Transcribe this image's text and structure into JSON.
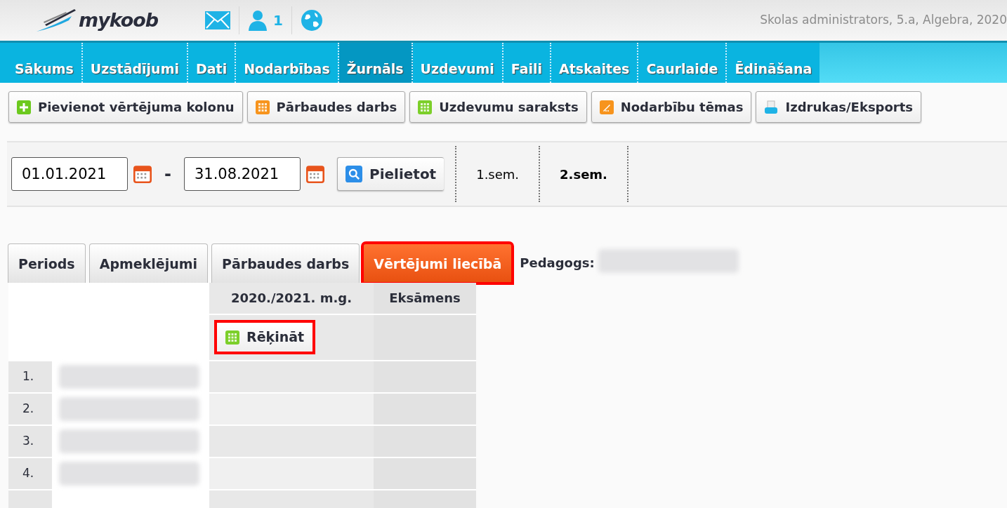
{
  "header": {
    "logo": "mykoob",
    "user_count": "1",
    "context": "Skolas administrators, 5.a, Algebra, 2020"
  },
  "nav": [
    {
      "label": "Sākums",
      "selected": false
    },
    {
      "label": "Uzstādījumi",
      "selected": false
    },
    {
      "label": "Dati",
      "selected": false
    },
    {
      "label": "Nodarbības",
      "selected": false
    },
    {
      "label": "Žurnāls",
      "selected": true
    },
    {
      "label": "Uzdevumi",
      "selected": false
    },
    {
      "label": "Faili",
      "selected": false
    },
    {
      "label": "Atskaites",
      "selected": false
    },
    {
      "label": "Caurlaide",
      "selected": false
    },
    {
      "label": "Ēdināšana",
      "selected": false
    }
  ],
  "toolbar": [
    "Pievienot vērtējuma kolonu",
    "Pārbaudes darbs",
    "Uzdevumu saraksts",
    "Nodarbību tēmas",
    "Izdrukas/Eksports"
  ],
  "date_filter": {
    "from": "01.01.2021",
    "separator": "-",
    "to": "31.08.2021",
    "apply": "Pielietot",
    "periods": [
      {
        "label": "1.sem.",
        "selected": false
      },
      {
        "label": "2.sem.",
        "selected": true
      }
    ]
  },
  "tabs": [
    {
      "label": "Periods",
      "selected": false,
      "highlighted": false
    },
    {
      "label": "Apmeklējumi",
      "selected": false,
      "highlighted": false
    },
    {
      "label": "Pārbaudes darbs",
      "selected": false,
      "highlighted": false
    },
    {
      "label": "Vērtējumi liecībā",
      "selected": true,
      "highlighted": true
    }
  ],
  "teacher_label": "Pedagogs:",
  "table": {
    "columns": [
      "2020./2021. m.g.",
      "Eksāmens"
    ],
    "calc_button": {
      "label": "Rēķināt",
      "highlighted": true
    },
    "rows": [
      {
        "number": "1."
      },
      {
        "number": "2."
      },
      {
        "number": "3."
      },
      {
        "number": "4."
      }
    ]
  }
}
